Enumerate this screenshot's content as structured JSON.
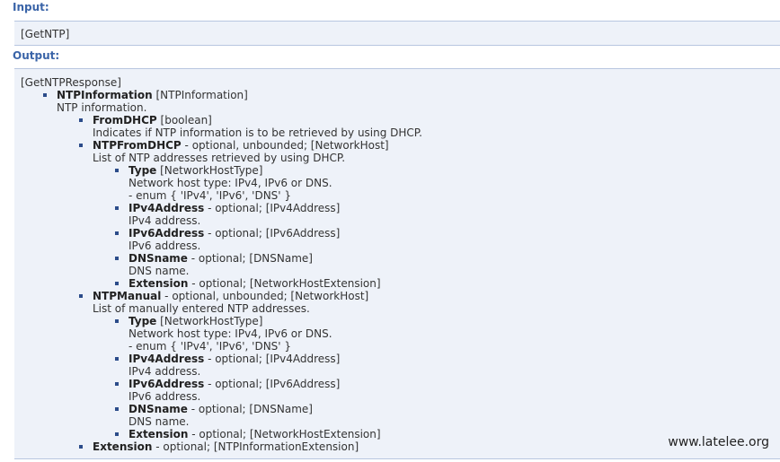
{
  "input_label": "Input:",
  "input_text": "[GetNTP]",
  "output_label": "Output:",
  "response_name": "[GetNTPResponse]",
  "items": [
    {
      "name": "NTPInformation",
      "type": " [NTPInformation]",
      "desc": "NTP information."
    },
    {
      "name": "FromDHCP",
      "type": " [boolean]",
      "desc": "Indicates if NTP information is to be retrieved by using DHCP."
    },
    {
      "name": "NTPFromDHCP",
      "type": " - optional, unbounded; [NetworkHost]",
      "desc": "List of NTP addresses retrieved by using DHCP."
    },
    {
      "name": "Type",
      "type": " [NetworkHostType]",
      "desc": "Network host type: IPv4, IPv6 or DNS.",
      "enum": "- enum { 'IPv4', 'IPv6', 'DNS' }"
    },
    {
      "name": "IPv4Address",
      "type": " - optional; [IPv4Address]",
      "desc": "IPv4 address."
    },
    {
      "name": "IPv6Address",
      "type": " - optional; [IPv6Address]",
      "desc": "IPv6 address."
    },
    {
      "name": "DNSname",
      "type": " - optional; [DNSName]",
      "desc": "DNS name."
    },
    {
      "name": "Extension",
      "type": " - optional; [NetworkHostExtension]"
    },
    {
      "name": "NTPManual",
      "type": " - optional, unbounded; [NetworkHost]",
      "desc": "List of manually entered NTP addresses."
    },
    {
      "name": "Type",
      "type": " [NetworkHostType]",
      "desc": "Network host type: IPv4, IPv6 or DNS.",
      "enum": "- enum { 'IPv4', 'IPv6', 'DNS' }"
    },
    {
      "name": "IPv4Address",
      "type": " - optional; [IPv4Address]",
      "desc": "IPv4 address."
    },
    {
      "name": "IPv6Address",
      "type": " - optional; [IPv6Address]",
      "desc": "IPv6 address."
    },
    {
      "name": "DNSname",
      "type": " - optional; [DNSName]",
      "desc": "DNS name."
    },
    {
      "name": "Extension",
      "type": " - optional; [NetworkHostExtension]"
    },
    {
      "name": "Extension",
      "type": " - optional; [NTPInformationExtension]"
    }
  ],
  "watermark": "www.latelee.org"
}
